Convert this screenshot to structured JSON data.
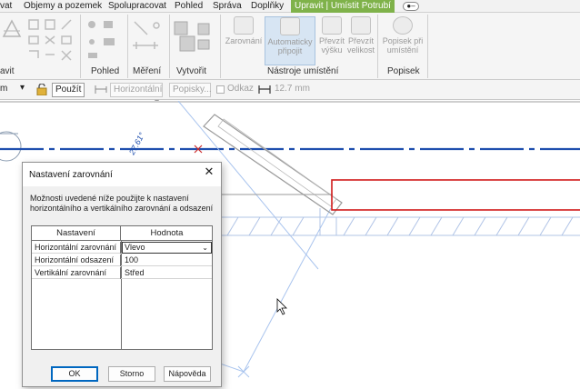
{
  "ribbon": {
    "tabs": [
      {
        "label": "vat"
      },
      {
        "label": "Objemy a pozemek"
      },
      {
        "label": "Spolupracovat"
      },
      {
        "label": "Pohled"
      },
      {
        "label": "Správa"
      },
      {
        "label": "Doplňky"
      },
      {
        "label": "Upravit | Umístit Potrubí"
      }
    ],
    "active_tab_color": "#7fb24a",
    "panels": {
      "left_label": "avit",
      "pohled": "Pohled",
      "mereni": "Měření",
      "vytvorit": "Vytvořit",
      "nastroje": "Nástroje umístění",
      "popisek": "Popisek"
    },
    "tools": {
      "zarovnani": "Zarovnání",
      "auto_1": "Automaticky",
      "auto_2": "připojit",
      "vysku_1": "Převzít",
      "vysku_2": "výšku",
      "velikost_1": "Převzít",
      "velikost_2": "velikost",
      "popisek_1": "Popisek při",
      "popisek_2": "umístění"
    }
  },
  "options_bar": {
    "left_fragment": "m",
    "apply": "Použít",
    "horizontal": "Horizontální",
    "tags": "Popisky...",
    "offset_label": "Odkaz",
    "length": "12.7 mm"
  },
  "canvas": {
    "angle_label": "27.61°"
  },
  "dialog": {
    "title": "Nastavení zarovnání",
    "description": "Možnosti uvedené níže použijte k nastavení horizontálního a vertikálního zarovnání a odsazení",
    "columns": [
      "Nastavení",
      "Hodnota"
    ],
    "rows": [
      {
        "name": "Horizontální zarovnání",
        "value": "Vlevo"
      },
      {
        "name": "Horizontální odsazení",
        "value": "100"
      },
      {
        "name": "Vertikální zarovnání",
        "value": "Střed"
      }
    ],
    "buttons": {
      "ok": "OK",
      "cancel": "Storno",
      "help": "Nápověda"
    }
  }
}
